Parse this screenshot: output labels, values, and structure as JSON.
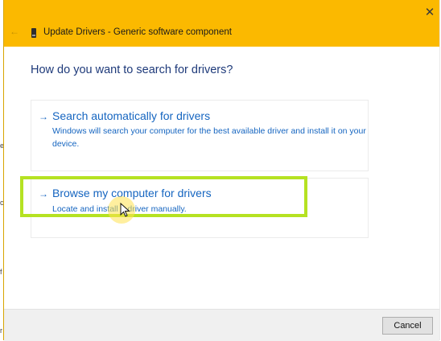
{
  "window": {
    "title": "Update Drivers - Generic software component",
    "close_glyph": "✕",
    "back_glyph": "←"
  },
  "main": {
    "question": "How do you want to search for drivers?",
    "options": [
      {
        "arrow": "→",
        "title": "Search automatically for drivers",
        "description": "Windows will search your computer for the best available driver and install it on your device."
      },
      {
        "arrow": "→",
        "title": "Browse my computer for drivers",
        "description": "Locate and install a driver manually."
      }
    ]
  },
  "footer": {
    "cancel_label": "Cancel"
  },
  "background_edge": {
    "glyphs": [
      "e",
      "c",
      "f",
      "r"
    ]
  },
  "colors": {
    "titlebar": "#fbb900",
    "link_blue": "#1565c0",
    "heading_blue": "#1e3a7a",
    "highlight": "#b5e222"
  }
}
